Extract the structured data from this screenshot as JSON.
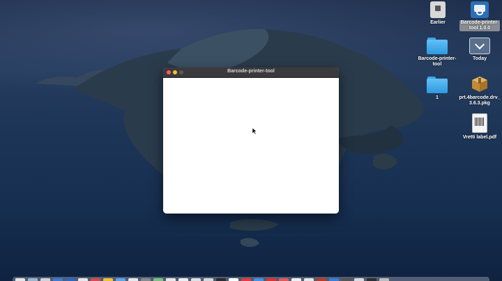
{
  "window": {
    "title": "Barcode-printer-tool"
  },
  "desktop_icons": {
    "earlier": "Earlier",
    "barcode_tool_line1": "Barcode-printer-",
    "barcode_tool_line2": "tool 1.0.0",
    "barcode_folder_line1": "Barcode-printer-",
    "barcode_folder_line2": "tool",
    "today": "Today",
    "folder_1": "1",
    "pkg_line1": "prt.4barcode.drv_",
    "pkg_line2": "3.6.3.pkg",
    "pdf": "Vretti label.pdf"
  },
  "colors": {
    "close": "#ff5f57",
    "minimize": "#febc2e",
    "folder_blue": "#3aa5e8",
    "titlebar": "#3a3a3c"
  },
  "dock_apps": [
    "#e6e6e6",
    "#9fb6c9",
    "#cfd3d8",
    "#3a7bd5",
    "#2e67c2",
    "#e8e8e8",
    "#d64d4d",
    "#f1c232",
    "#5aa7e8",
    "#e9e9e9",
    "#8a8a8a",
    "#7dc47d",
    "#e9e9e9",
    "#efefef",
    "#e0e0e0",
    "#d9d9d9",
    "#2d2d2d",
    "#fff",
    "#e63b3b",
    "#4a90e2",
    "#d33",
    "#e05a5a",
    "#f0f0f0",
    "#e8e8e8",
    "#c0392b",
    "#3b7dd8",
    "#555",
    "#dcdcdc",
    "#2f2f2f",
    "#bdbdbd"
  ]
}
